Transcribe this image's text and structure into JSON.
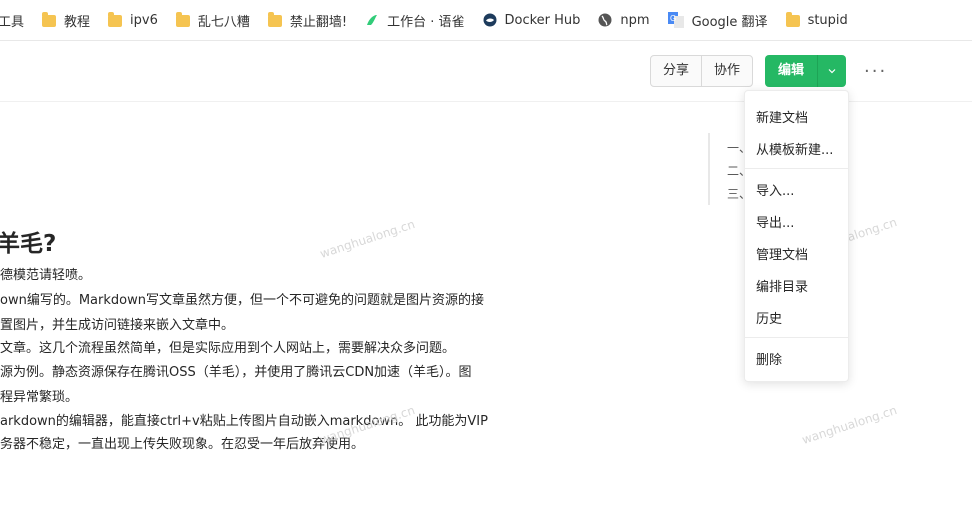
{
  "bookmarks": [
    {
      "label": "工具",
      "icon": "tool-icon"
    },
    {
      "label": "教程",
      "icon": "folder-icon"
    },
    {
      "label": "ipv6",
      "icon": "folder-icon"
    },
    {
      "label": "乱七八糟",
      "icon": "folder-icon"
    },
    {
      "label": "禁止翻墙!",
      "icon": "folder-icon"
    },
    {
      "label": "工作台 · 语雀",
      "icon": "yuque-icon"
    },
    {
      "label": "Docker Hub",
      "icon": "docker-icon"
    },
    {
      "label": "npm",
      "icon": "globe-icon"
    },
    {
      "label": "Google 翻译",
      "icon": "google-translate-icon"
    },
    {
      "label": "stupid",
      "icon": "folder-icon"
    }
  ],
  "toolbar": {
    "share_label": "分享",
    "collab_label": "协作",
    "edit_label": "编辑",
    "more_label": "···"
  },
  "article": {
    "heading": "羊毛?",
    "paragraphs": [
      "德模范请轻喷。",
      "own编写的。Markdown写文章虽然方便，但一个不可避免的问题就是图片资源的接",
      "置图片，并生成访问链接来嵌入文章中。",
      "文章。这几个流程虽然简单，但是实际应用到个人网站上，需要解决众多问题。",
      "源为例。静态资源保存在腾讯OSS（羊毛），并使用了腾讯云CDN加速（羊毛）。图",
      "程异常繁琐。",
      "arkdown的编辑器，能直接ctrl+v粘贴上传图片自动嵌入markdown。 此功能为VIP",
      "务器不稳定，一直出现上传失败现象。在忍受一年后放弃使用。"
    ],
    "watermark": "wanghualong.cn"
  },
  "toc": {
    "items": [
      "一、",
      "二、",
      "三、"
    ],
    "partial_suffix": "?"
  },
  "menu": {
    "items": [
      {
        "label": "新建文档"
      },
      {
        "label": "从模板新建..."
      },
      {
        "label": "导入..."
      },
      {
        "label": "导出..."
      },
      {
        "label": "管理文档"
      },
      {
        "label": "编排目录"
      },
      {
        "label": "历史"
      },
      {
        "label": "删除"
      }
    ]
  },
  "colors": {
    "accent": "#25b864",
    "folder": "#f5c451"
  }
}
